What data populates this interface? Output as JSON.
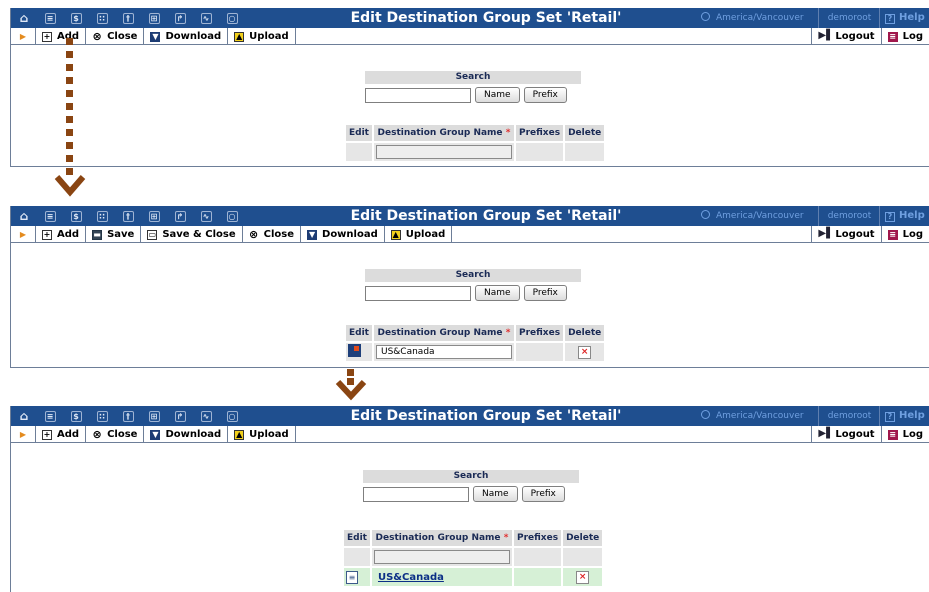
{
  "panels": [
    {
      "title": "Edit Destination Group Set 'Retail'",
      "timezone": "America/Vancouver",
      "user": "demoroot",
      "help": "Help",
      "toolbar": {
        "add": "Add",
        "close": "Close",
        "download": "Download",
        "upload": "Upload",
        "logout": "Logout",
        "log": "Log"
      },
      "search": {
        "header": "Search",
        "name_btn": "Name",
        "prefix_btn": "Prefix"
      },
      "table": {
        "edit": "Edit",
        "name": "Destination Group Name",
        "prefixes": "Prefixes",
        "delete": "Delete"
      }
    },
    {
      "title": "Edit Destination Group Set 'Retail'",
      "timezone": "America/Vancouver",
      "user": "demoroot",
      "help": "Help",
      "toolbar": {
        "add": "Add",
        "save": "Save",
        "save_close": "Save & Close",
        "close": "Close",
        "download": "Download",
        "upload": "Upload",
        "logout": "Logout",
        "log": "Log"
      },
      "search": {
        "header": "Search",
        "name_btn": "Name",
        "prefix_btn": "Prefix"
      },
      "table": {
        "edit": "Edit",
        "name": "Destination Group Name",
        "prefixes": "Prefixes",
        "delete": "Delete",
        "row_value": "US&Canada"
      }
    },
    {
      "title": "Edit Destination Group Set 'Retail'",
      "timezone": "America/Vancouver",
      "user": "demoroot",
      "help": "Help",
      "toolbar": {
        "add": "Add",
        "close": "Close",
        "download": "Download",
        "upload": "Upload",
        "logout": "Logout",
        "log": "Log"
      },
      "search": {
        "header": "Search",
        "name_btn": "Name",
        "prefix_btn": "Prefix"
      },
      "table": {
        "edit": "Edit",
        "name": "Destination Group Name",
        "prefixes": "Prefixes",
        "delete": "Delete",
        "row_link": "US&Canada"
      }
    }
  ],
  "colors": {
    "titlebar": "#1f4f8f",
    "step_arrow": "#8a4512",
    "saved_row": "#d6f0d6"
  }
}
